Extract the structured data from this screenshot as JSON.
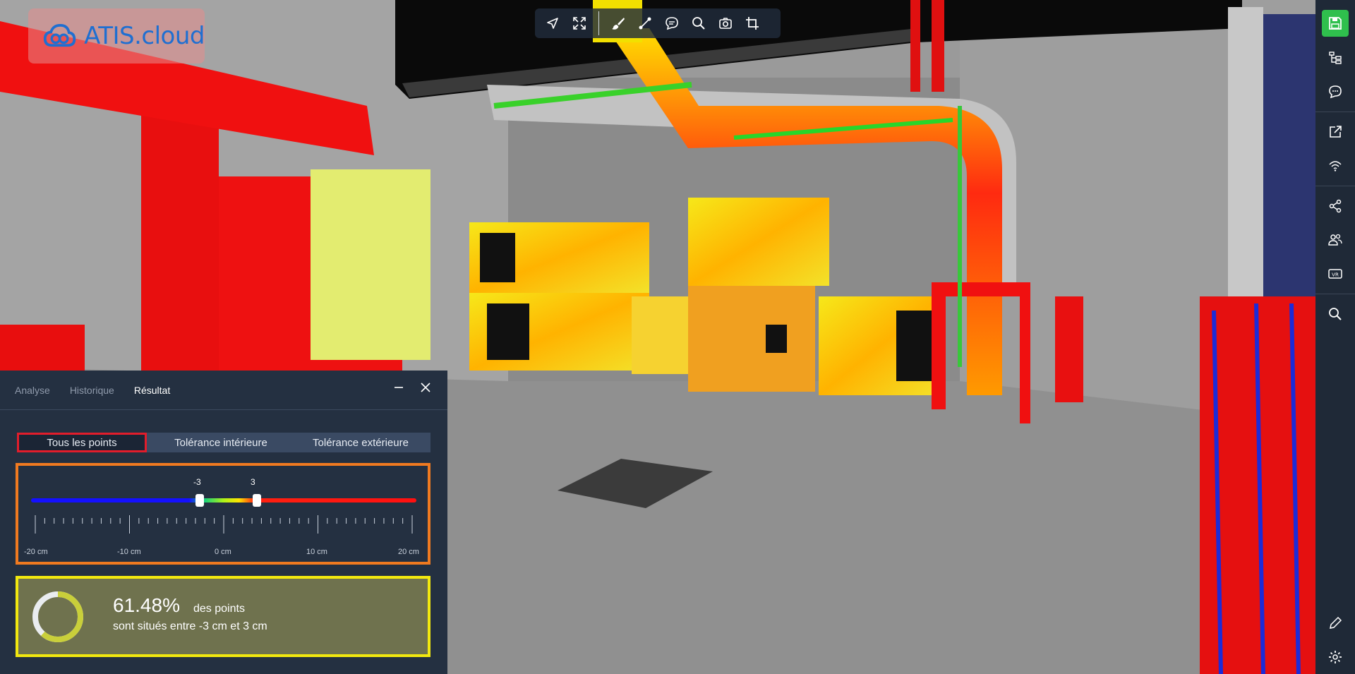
{
  "app": {
    "brand": "ATIS.cloud"
  },
  "toolbar": {
    "tools": [
      "navigate-icon",
      "fullscreen-icon",
      "brush-icon",
      "measure-icon",
      "comment-icon",
      "search-icon",
      "camera-icon",
      "crop-icon"
    ]
  },
  "rightbar": {
    "items": [
      "save-icon",
      "tree-icon",
      "chat-icon",
      "external-link-icon",
      "wifi-icon",
      "share-icon",
      "users-icon",
      "vr-icon",
      "search-icon",
      "pencil-icon",
      "settings-icon"
    ]
  },
  "panel": {
    "tabs": [
      "Analyse",
      "Historique",
      "Résultat"
    ],
    "active_tab": "Résultat",
    "segments": [
      "Tous les points",
      "Tolérance intérieure",
      "Tolérance extérieure"
    ],
    "selected_segment": "Tous les points",
    "slider": {
      "min_value": "-3",
      "max_value": "3",
      "min": -3,
      "max": 3,
      "range": [
        -20,
        20
      ],
      "scale_labels": [
        "-20 cm",
        "-10 cm",
        "0 cm",
        "10 cm",
        "20 cm"
      ]
    },
    "result": {
      "percent": "61.48%",
      "percent_value": 61.48,
      "suffix": "des points",
      "sentence": "sont situés entre -3 cm et 3 cm"
    }
  },
  "colors": {
    "accent_red": "#e21d2b",
    "accent_orange": "#f07a20",
    "accent_yellow": "#f2e80f",
    "save_green": "#2fbf4d"
  }
}
